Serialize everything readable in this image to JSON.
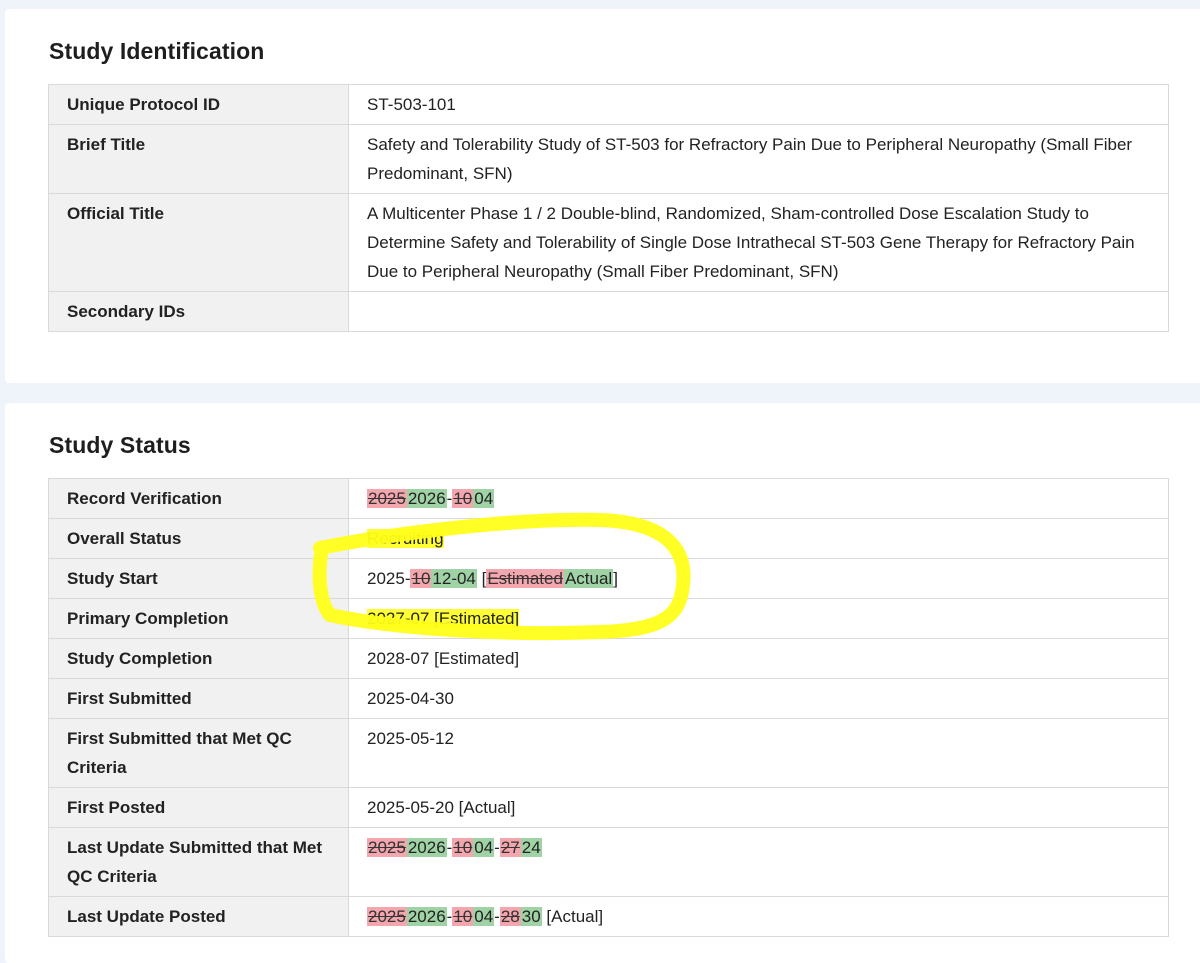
{
  "identification": {
    "heading": "Study Identification",
    "rows": [
      {
        "label": "Unique Protocol ID",
        "value": "ST-503-101"
      },
      {
        "label": "Brief Title",
        "value": "Safety and Tolerability Study of ST-503 for Refractory Pain Due to Peripheral Neuropathy (Small Fiber Predominant, SFN)"
      },
      {
        "label": "Official Title",
        "value": "A Multicenter Phase 1 / 2 Double-blind, Randomized, Sham-controlled Dose Escalation Study to Determine Safety and Tolerability of Single Dose Intrathecal ST-503 Gene Therapy for Refractory Pain Due to Peripheral Neuropathy (Small Fiber Predominant, SFN)"
      },
      {
        "label": "Secondary IDs",
        "value": ""
      }
    ]
  },
  "status": {
    "heading": "Study Status",
    "record_verification": {
      "label": "Record Verification",
      "old_year": "2025",
      "new_year": "2026",
      "sep": "-",
      "old_month": "10",
      "new_month": "04"
    },
    "overall_status": {
      "label": "Overall Status",
      "value": "Recruiting"
    },
    "study_start": {
      "label": "Study Start",
      "prefix": "2025-",
      "old_month": "10",
      "new_month_day": "12-04",
      "open": " [",
      "old_type": "Estimated",
      "new_type": "Actual",
      "close": "]"
    },
    "primary_completion": {
      "label": "Primary Completion",
      "value": "2027-07 [Estimated]"
    },
    "study_completion": {
      "label": "Study Completion",
      "value": "2028-07 [Estimated]"
    },
    "first_submitted": {
      "label": "First Submitted",
      "value": "2025-04-30"
    },
    "first_submitted_qc": {
      "label": "First Submitted that Met QC Criteria",
      "value": "2025-05-12"
    },
    "first_posted": {
      "label": "First Posted",
      "value": "2025-05-20 [Actual]"
    },
    "last_update_qc": {
      "label": "Last Update Submitted that Met QC Criteria",
      "old_year": "2025",
      "new_year": "2026",
      "sep": "-",
      "old_month": "10",
      "new_month": "04",
      "old_day": "27",
      "new_day": "24"
    },
    "last_update_posted": {
      "label": "Last Update Posted",
      "old_year": "2025",
      "new_year": "2026",
      "sep": "-",
      "old_month": "10",
      "new_month": "04",
      "old_day": "28",
      "new_day": "30",
      "suffix": " [Actual]"
    }
  },
  "colors": {
    "removed": "#f3a6ad",
    "added": "#9fd2a4",
    "highlight": "#ffff35"
  }
}
